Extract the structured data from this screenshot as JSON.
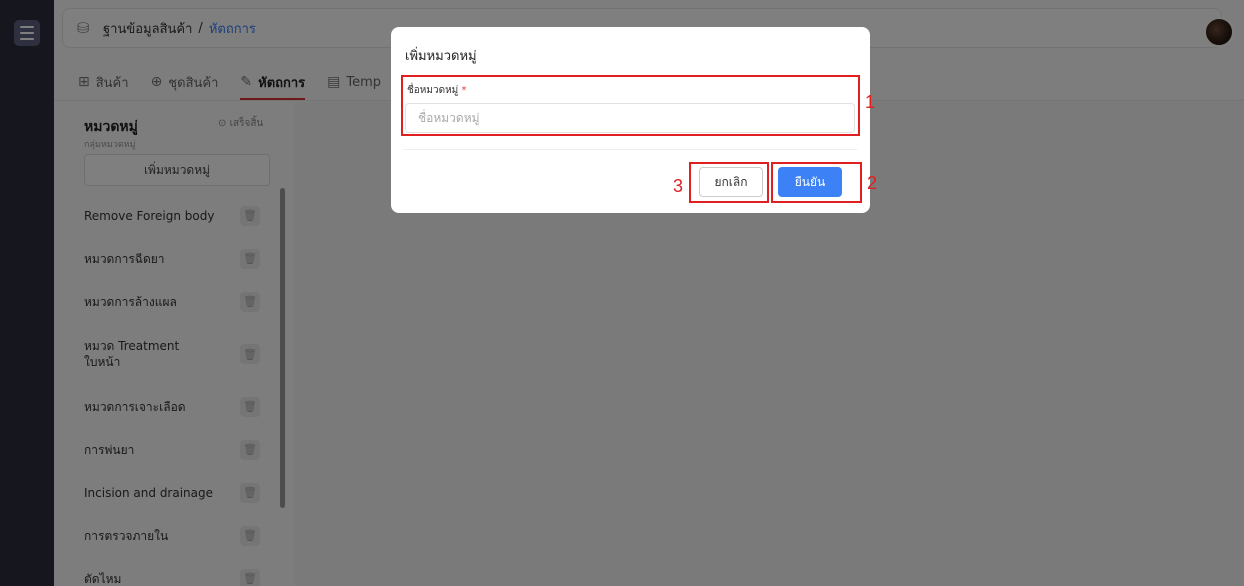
{
  "header": {
    "breadcrumb_root": "ฐานข้อมูลสินค้า",
    "breadcrumb_sep": "/",
    "breadcrumb_current": "หัตถการ"
  },
  "tabs": [
    {
      "label": "สินค้า",
      "icon": "product-icon"
    },
    {
      "label": "ชุดสินค้า",
      "icon": "bundle-icon"
    },
    {
      "label": "หัตถการ",
      "icon": "procedure-icon",
      "active": true
    },
    {
      "label": "Temp",
      "icon": "template-icon"
    }
  ],
  "sidebar": {
    "title": "หมวดหมู่",
    "subtitle": "กลุ่มหมวดหมู่",
    "done_label": "เสร็จสิ้น",
    "add_button": "เพิ่มหมวดหมู่",
    "items": [
      "Remove Foreign body",
      "หมวดการฉีดยา",
      "หมวดการล้างแผล",
      "หมวด Treatment ใบหน้า",
      "หมวดการเจาะเลือด",
      "การพ่นยา",
      "Incision and drainage",
      "การตรวจภายใน",
      "ตัดไหม"
    ]
  },
  "modal": {
    "title": "เพิ่มหมวดหมู่",
    "field_label": "ชื่อหมวดหมู่",
    "field_required_mark": "*",
    "field_placeholder": "ชื่อหมวดหมู่",
    "cancel_label": "ยกเลิก",
    "confirm_label": "ยืนยัน"
  },
  "annotations": [
    "1",
    "2",
    "3"
  ],
  "colors": {
    "accent": "#3c82f6",
    "annotation": "#e02020",
    "rail": "#2d2f3c"
  }
}
